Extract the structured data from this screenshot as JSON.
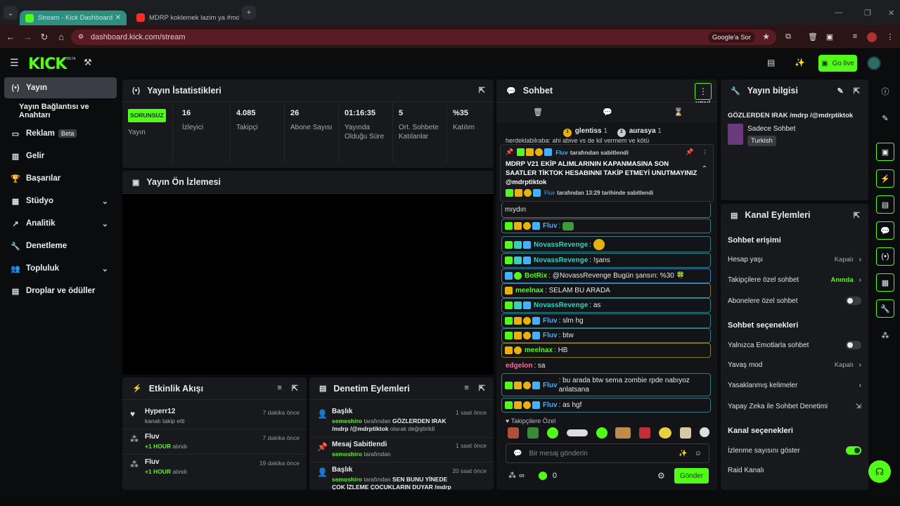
{
  "browser": {
    "tabs": [
      {
        "title": "Stream - Kick Dashboard",
        "active": true
      },
      {
        "title": "MDRP koklemek lazim ya #mdr",
        "active": false
      }
    ],
    "url": "dashboard.kick.com/stream",
    "ask_google": "Google'a Sor"
  },
  "header": {
    "logo": "KICK",
    "beta": "BETA",
    "go_live": "Go live"
  },
  "sidebar": {
    "items": [
      {
        "label": "Yayın",
        "icon": "broadcast-icon"
      },
      {
        "label": "Yayın Bağlantısı ve Anahtarı"
      },
      {
        "label": "Reklam",
        "badge": "Beta",
        "icon": "ad-icon"
      },
      {
        "label": "Gelir",
        "icon": "revenue-icon"
      },
      {
        "label": "Başarılar",
        "icon": "trophy-icon"
      },
      {
        "label": "Stüdyo",
        "icon": "studio-icon"
      },
      {
        "label": "Analitik",
        "icon": "analytics-icon"
      },
      {
        "label": "Denetleme",
        "icon": "wrench-icon"
      },
      {
        "label": "Topluluk",
        "icon": "community-icon"
      },
      {
        "label": "Droplar ve ödüller",
        "icon": "drops-icon"
      }
    ]
  },
  "stats": {
    "title": "Yayın İstatistikleri",
    "cells": [
      {
        "value": "SORUNSUZ",
        "label": "Yayın"
      },
      {
        "value": "16",
        "label": "İzleyici"
      },
      {
        "value": "4.085",
        "label": "Takipçi"
      },
      {
        "value": "26",
        "label": "Abone Sayısı"
      },
      {
        "value": "01:16:35",
        "label": "Yayında Olduğu Süre"
      },
      {
        "value": "5",
        "label": "Ort. Sohbete Katılanlar"
      },
      {
        "value": "%35",
        "label": "Katılım"
      }
    ]
  },
  "preview": {
    "title": "Yayın Ön İzlemesi"
  },
  "activity": {
    "title": "Etkinlik Akışı",
    "items": [
      {
        "user": "Hyperr12",
        "action": "kanalı takip etti",
        "time": "7 dakika önce"
      },
      {
        "user": "Fluv",
        "reward": "+1 HOUR",
        "action": "alındı",
        "time": "7 dakika önce"
      },
      {
        "user": "Fluv",
        "reward": "+1 HOUR",
        "action": "alındı",
        "time": "19 dakika önce"
      }
    ]
  },
  "moderation": {
    "title": "Denetim Eylemleri",
    "items": [
      {
        "type": "Başlık",
        "user": "semoshiro",
        "mid": "tarafından",
        "value": "GÖZLERDEN IRAK /mdrp /@mdrptiktok",
        "suffix": "olarak değiştirildi",
        "time": "1 saat önce"
      },
      {
        "type": "Mesaj Sabitlendi",
        "user": "semoshiro",
        "mid": "tarafından",
        "time": "1 saat önce"
      },
      {
        "type": "Başlık",
        "user": "semoshiro",
        "mid": "tarafından",
        "value": "SEN BUNU YİNEDE ÇOK İZLEME ÇOCUKLARIN DUYAR /mdrp /@mdrptiktok",
        "suffix": "olarak",
        "time": "20 saat önce"
      }
    ]
  },
  "chat": {
    "title": "Sohbet",
    "new_label": "YENİ",
    "top_users": [
      {
        "rank": "1",
        "name": "glentiss",
        "count": "1"
      },
      {
        "rank": "2",
        "name": "aurasya",
        "count": "1"
      }
    ],
    "clipped_top": "herdeklabilraba: ahi abiye vs de kil vermem ve kötü",
    "pinned": {
      "by_user": "Fluv",
      "by_text": "tarafından sabitlendi",
      "message": "MDRP V21 EKİP ALIMLARININ KAPANMASINA SON SAATLER TİKTOK HESABINNI TAKİP ETMEYİ UNUTMAYINIZ @mdrptiktok",
      "footer_user": "Fluv",
      "footer_text": "tarafından 13:29 tarihinde sabitlendi"
    },
    "messages": [
      {
        "user": "",
        "text": "mıydın",
        "style": "sub"
      },
      {
        "user": "Fluv",
        "text": ":",
        "style": "sub",
        "color": "#3fb3ff",
        "emote": "#3a9b3a"
      },
      {
        "user": "NovassRevenge",
        "text": ":",
        "style": "sub",
        "color": "#36d0c0",
        "emote": "#e8b10e"
      },
      {
        "user": "NovassRevenge",
        "text": ": !şans",
        "style": "sub",
        "color": "#36d0c0"
      },
      {
        "user": "BotRix",
        "text": ": @NovassRevenge Bugün şansın: %30 🍀",
        "style": "blue",
        "color": "#53fc18"
      },
      {
        "user": "meelnax",
        "text": ": SELAM BU ARADA",
        "style": "gold",
        "color": "#53fc18"
      },
      {
        "user": "NovassRevenge",
        "text": ": as",
        "style": "sub",
        "color": "#36d0c0"
      },
      {
        "user": "Fluv",
        "text": ": slm hg",
        "style": "sub",
        "color": "#3fb3ff"
      },
      {
        "user": "Fluv",
        "text": ": btw",
        "style": "sub",
        "color": "#3fb3ff"
      },
      {
        "user": "meelnax",
        "text": ": HB",
        "style": "gold",
        "color": "#53fc18"
      },
      {
        "user": "edgelon",
        "text": ": sa",
        "style": "plain",
        "color": "#ff6b9a"
      },
      {
        "user": "Fluv",
        "text": ": bu arada btw sema zombie rpde nabıyoz anlatsana",
        "style": "sub",
        "color": "#3fb3ff"
      },
      {
        "user": "Fluv",
        "text": ": as hgf",
        "style": "sub",
        "color": "#3fb3ff"
      }
    ],
    "followers_only": "Takipçilere Özel",
    "input_placeholder": "Bir mesaj gönderin",
    "infinity": "∞",
    "count": "0",
    "send": "Gönder"
  },
  "stream_info": {
    "title": "Yayın bilgisi",
    "stream_title": "GÖZLERDEN IRAK /mdrp /@mdrptiktok",
    "category": "Sadece Sohbet",
    "language": "Turkish"
  },
  "channel_actions": {
    "title": "Kanal Eylemleri",
    "chat_access": "Sohbet erişimi",
    "account_age": {
      "label": "Hesap yaşı",
      "value": "Kapalı"
    },
    "followers_chat": {
      "label": "Takipçilere özel sohbet",
      "value": "Anında"
    },
    "subs_chat": {
      "label": "Abonelere özel sohbet"
    },
    "chat_options": "Sohbet seçenekleri",
    "emotes_only": {
      "label": "Yalnızca Emotlarla sohbet"
    },
    "slow_mode": {
      "label": "Yavaş mod",
      "value": "Kapalı"
    },
    "banned_words": {
      "label": "Yasaklanmış kelimeler"
    },
    "ai_mod": {
      "label": "Yapay Zeka ile Sohbet Denetimi"
    },
    "channel_options": "Kanal seçenekleri",
    "show_viewers": {
      "label": "İzlenme sayısını göster"
    },
    "raid": {
      "label": "Raid Kanalı"
    }
  },
  "colors": {
    "accent": "#53fc18",
    "tab": "#2c8f80",
    "addrbar": "#5a1c24"
  }
}
